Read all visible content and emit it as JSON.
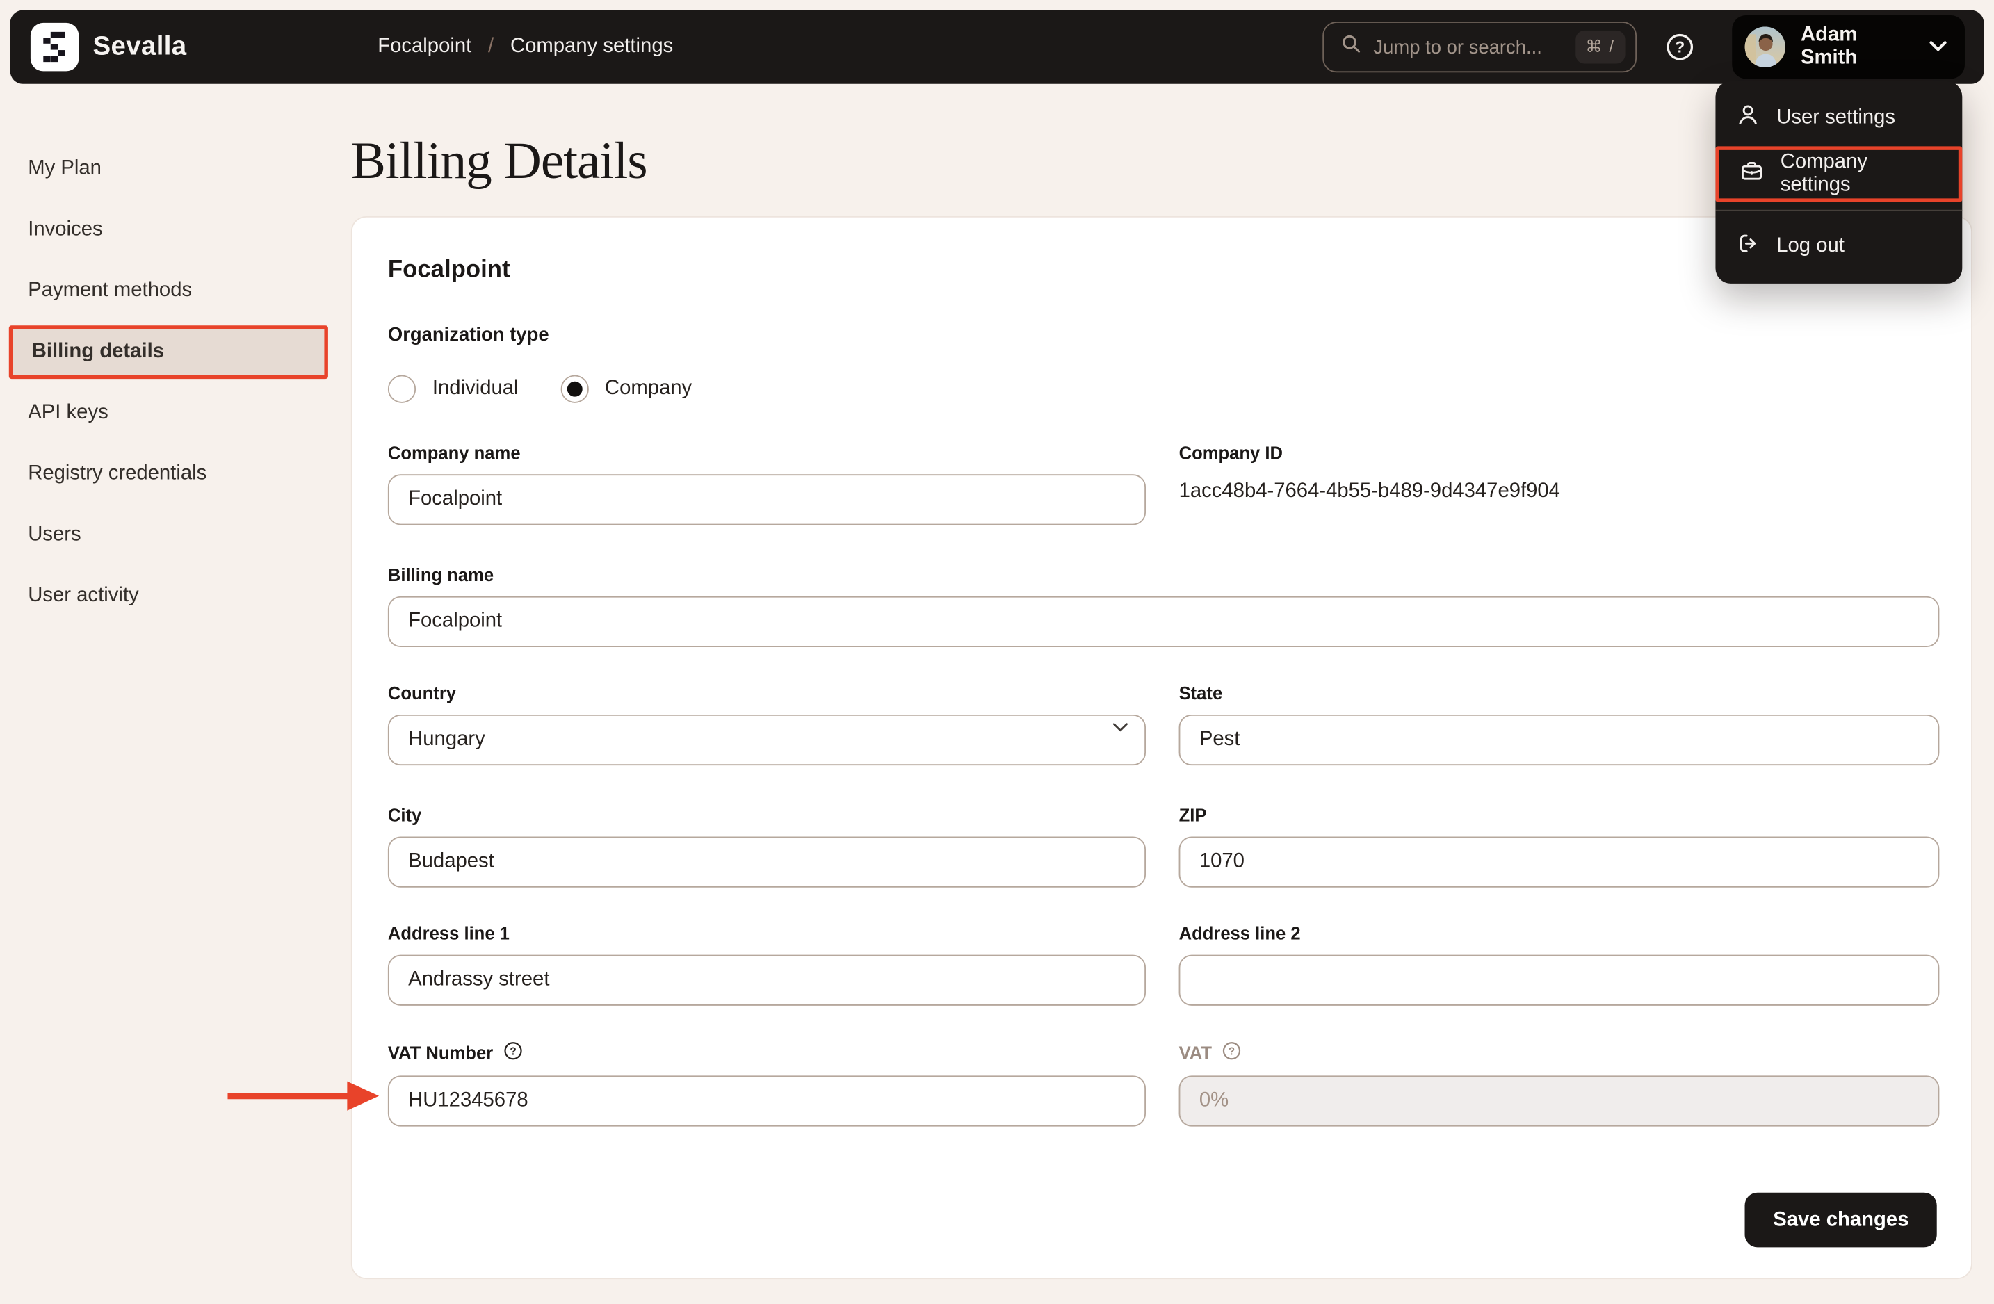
{
  "colors": {
    "accent_red": "#E8432A",
    "topbar_bg": "#1B1817",
    "page_bg": "#F7F1EC",
    "card_bg": "#FFFFFF",
    "input_border": "#B6A89D",
    "sidebar_highlight_bg": "#E6DBD3",
    "disabled_input_bg": "#F0EDEC",
    "muted_text": "#9B8B81"
  },
  "topbar": {
    "brand": "Sevalla",
    "breadcrumb": {
      "parent": "Focalpoint",
      "separator": "/",
      "current": "Company settings"
    },
    "search": {
      "placeholder": "Jump to or search...",
      "shortcut": "⌘ /"
    },
    "user": {
      "name": "Adam Smith"
    }
  },
  "user_menu": {
    "items": [
      {
        "label": "User settings",
        "icon": "user-icon"
      },
      {
        "label": "Company settings",
        "icon": "briefcase-icon",
        "annotated": true
      },
      {
        "label": "Log out",
        "icon": "logout-icon"
      }
    ]
  },
  "sidebar": {
    "items": [
      {
        "label": "My Plan",
        "active": false
      },
      {
        "label": "Invoices",
        "active": false
      },
      {
        "label": "Payment methods",
        "active": false
      },
      {
        "label": "Billing details",
        "active": true
      },
      {
        "label": "API keys",
        "active": false
      },
      {
        "label": "Registry credentials",
        "active": false
      },
      {
        "label": "Users",
        "active": false
      },
      {
        "label": "User activity",
        "active": false
      }
    ]
  },
  "page": {
    "title": "Billing Details"
  },
  "form": {
    "company_title": "Focalpoint",
    "organization_type": {
      "label": "Organization type",
      "options": [
        {
          "label": "Individual",
          "selected": false
        },
        {
          "label": "Company",
          "selected": true
        }
      ]
    },
    "company_name": {
      "label": "Company name",
      "value": "Focalpoint"
    },
    "company_id": {
      "label": "Company ID",
      "value": "1acc48b4-7664-4b55-b489-9d4347e9f904"
    },
    "billing_name": {
      "label": "Billing name",
      "value": "Focalpoint"
    },
    "country": {
      "label": "Country",
      "value": "Hungary"
    },
    "state": {
      "label": "State",
      "value": "Pest"
    },
    "city": {
      "label": "City",
      "value": "Budapest"
    },
    "zip": {
      "label": "ZIP",
      "value": "1070"
    },
    "address1": {
      "label": "Address line 1",
      "value": "Andrassy street"
    },
    "address2": {
      "label": "Address line 2",
      "value": ""
    },
    "vat_number": {
      "label": "VAT Number",
      "value": "HU12345678"
    },
    "vat": {
      "label": "VAT",
      "value": "0%",
      "disabled": true
    },
    "save_label": "Save changes"
  }
}
